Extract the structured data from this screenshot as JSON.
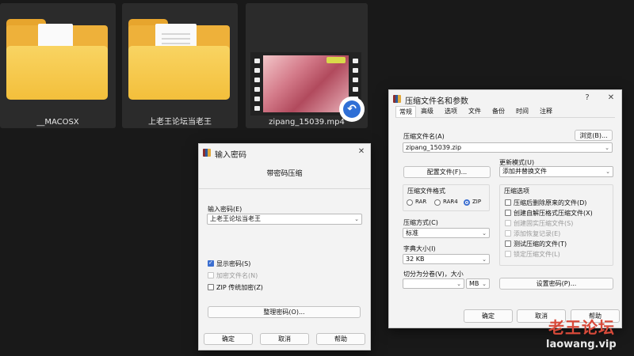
{
  "explorer": {
    "items": [
      {
        "label": "__MACOSX",
        "icon": "folder-icon"
      },
      {
        "label": "上老王论坛当老王",
        "icon": "folder-icon"
      },
      {
        "label": "zipang_15039.mp4",
        "icon": "video-thumbnail"
      }
    ]
  },
  "password_dialog": {
    "title": "输入密码",
    "heading": "带密码压缩",
    "input_label": "输入密码(E)",
    "input_value": "上老王论坛当老王",
    "options": [
      {
        "label": "显示密码(S)",
        "checked": true,
        "disabled": false
      },
      {
        "label": "加密文件名(N)",
        "checked": false,
        "disabled": true
      },
      {
        "label": "ZIP 传统加密(Z)",
        "checked": false,
        "disabled": false
      }
    ],
    "organize_button": "整理密码(O)...",
    "ok": "确定",
    "cancel": "取消",
    "help": "帮助",
    "close": "✕"
  },
  "archive_dialog": {
    "title": "压缩文件名和参数",
    "help_glyph": "?",
    "close": "✕",
    "tabs": [
      "常规",
      "高级",
      "选项",
      "文件",
      "备份",
      "时间",
      "注释"
    ],
    "active_tab": "常规",
    "filename_label": "压缩文件名(A)",
    "browse_button": "浏览(B)...",
    "filename_value": "zipang_15039.zip",
    "profile_button": "配置文件(F)...",
    "update_label": "更新模式(U)",
    "update_value": "添加并替换文件",
    "format_label": "压缩文件格式",
    "formats": [
      {
        "label": "RAR",
        "selected": false
      },
      {
        "label": "RAR4",
        "selected": false
      },
      {
        "label": "ZIP",
        "selected": true
      }
    ],
    "method_label": "压缩方式(C)",
    "method_value": "标准",
    "dict_label": "字典大小(I)",
    "dict_value": "32 KB",
    "split_label": "切分为分卷(V)，大小",
    "split_value": "",
    "split_unit": "MB",
    "options_label": "压缩选项",
    "options": [
      {
        "label": "压缩后删除原来的文件(D)",
        "checked": false,
        "disabled": false
      },
      {
        "label": "创建自解压格式压缩文件(X)",
        "checked": false,
        "disabled": false
      },
      {
        "label": "创建固实压缩文件(S)",
        "checked": false,
        "disabled": true
      },
      {
        "label": "添加恢复记录(E)",
        "checked": false,
        "disabled": true
      },
      {
        "label": "测试压缩的文件(T)",
        "checked": false,
        "disabled": false
      },
      {
        "label": "锁定压缩文件(L)",
        "checked": false,
        "disabled": true
      }
    ],
    "set_password_button": "设置密码(P)...",
    "ok": "确定",
    "cancel": "取消",
    "help": "帮助"
  },
  "watermark": {
    "line1": "老王论坛",
    "line2": "laowang.vip"
  }
}
